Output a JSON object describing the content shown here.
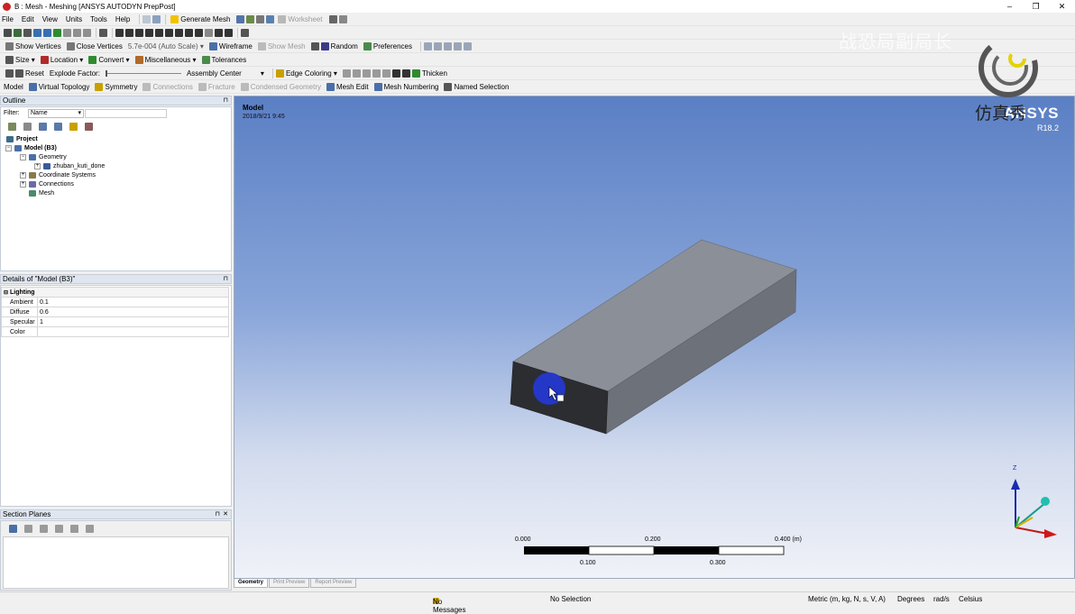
{
  "window": {
    "title": "B : Mesh - Meshing [ANSYS AUTODYN PrepPost]",
    "controls": [
      "–",
      "❐",
      "✕"
    ]
  },
  "menu": [
    "File",
    "Edit",
    "View",
    "Units",
    "Tools",
    "Help"
  ],
  "toolbar1": {
    "generate_mesh": "Generate Mesh",
    "worksheet": "Worksheet"
  },
  "toolbar3": {
    "show_vertices": "Show Vertices",
    "close_vertices": "Close Vertices",
    "scale": "5.7e-004 (Auto Scale)",
    "wireframe": "Wireframe",
    "show_mesh": "Show Mesh",
    "random": "Random",
    "preferences": "Preferences"
  },
  "toolbar4": {
    "size": "Size",
    "location": "Location",
    "convert": "Convert",
    "miscellaneous": "Miscellaneous",
    "tolerances": "Tolerances"
  },
  "toolbar5": {
    "reset": "Reset",
    "explode_factor": "Explode Factor:",
    "assembly_center": "Assembly Center",
    "edge_coloring": "Edge Coloring",
    "thicken": "Thicken"
  },
  "toolbar6": {
    "model": "Model",
    "virtual_topology": "Virtual Topology",
    "symmetry": "Symmetry",
    "connections": "Connections",
    "fracture": "Fracture",
    "condensed_geometry": "Condensed Geometry",
    "mesh_edit": "Mesh Edit",
    "mesh_numbering": "Mesh Numbering",
    "named_selection": "Named Selection"
  },
  "outline": {
    "title": "Outline",
    "filter_label": "Filter:",
    "filter_value": "Name",
    "tree": {
      "project": "Project",
      "model": "Model (B3)",
      "geometry": "Geometry",
      "body": "zhuban_kuti_done",
      "coordinate_systems": "Coordinate Systems",
      "connections": "Connections",
      "mesh": "Mesh"
    }
  },
  "details": {
    "title": "Details of \"Model (B3)\"",
    "section": "Lighting",
    "rows": [
      {
        "label": "Ambient",
        "value": "0.1"
      },
      {
        "label": "Diffuse",
        "value": "0.6"
      },
      {
        "label": "Specular",
        "value": "1"
      },
      {
        "label": "Color",
        "value": ""
      }
    ]
  },
  "section_planes": {
    "title": "Section Planes"
  },
  "viewport": {
    "model_label": "Model",
    "timestamp": "2018/9/21 9:45",
    "brand": "ANSYS",
    "version": "R18.2",
    "watermark_cn": "仿真秀",
    "watermark_top": "战恐局副局长",
    "scale": {
      "ticks_top": [
        "0.000",
        "0.200",
        "0.400 (m)"
      ],
      "ticks_bottom": [
        "0.100",
        "0.300"
      ]
    },
    "axis_z": "Z"
  },
  "tabs": [
    "Geometry",
    "Print Preview",
    "Report Preview"
  ],
  "status": {
    "messages": "No Messages",
    "selection": "No Selection",
    "units": "Metric (m, kg, N, s, V, A)",
    "angle": "Degrees",
    "rate": "rad/s",
    "temp": "Celsius"
  },
  "colors": {
    "viewport_top": "#5a7fc4",
    "box_top": "#8a8e96",
    "box_front": "#2b2d31",
    "box_side": "#6c7079",
    "cursor_highlight": "#2438d8"
  }
}
